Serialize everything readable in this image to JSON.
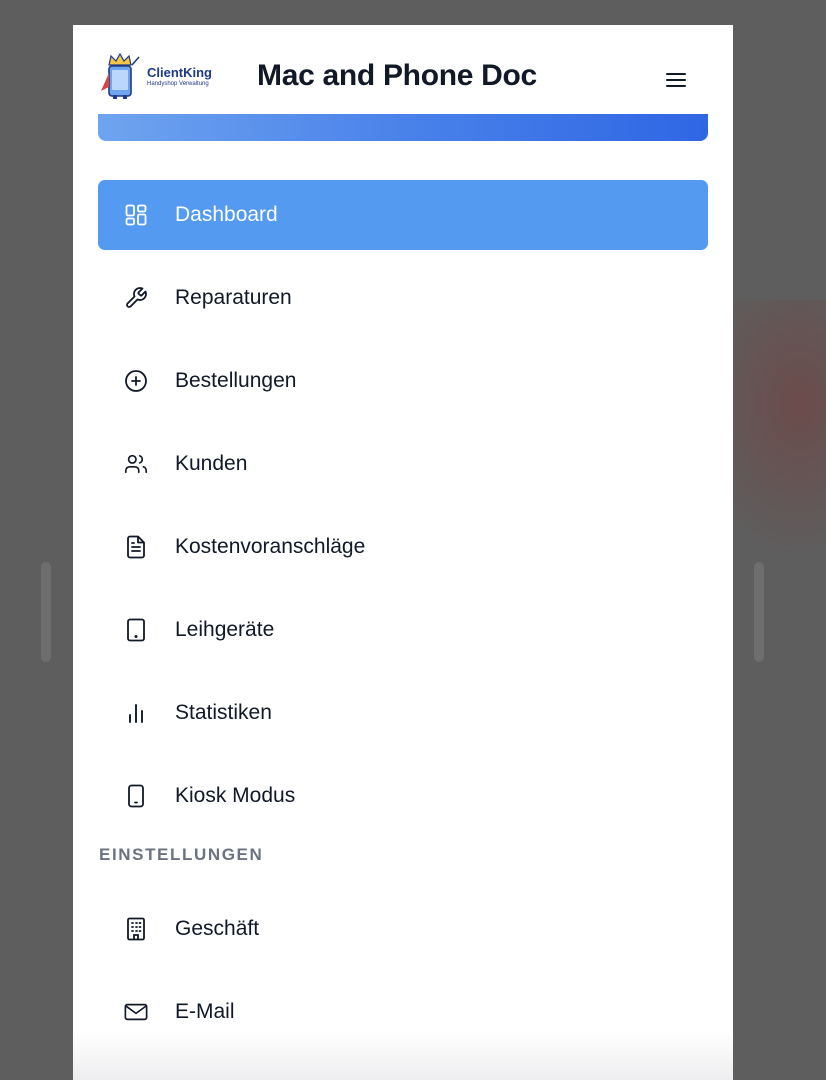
{
  "app": {
    "logo_name": "ClientKing",
    "logo_tagline": "Handyshop Verwaltung",
    "title": "Mac and Phone Doc"
  },
  "nav": {
    "items": [
      {
        "label": "Dashboard",
        "icon": "grid-icon",
        "active": true
      },
      {
        "label": "Reparaturen",
        "icon": "wrench-icon"
      },
      {
        "label": "Bestellungen",
        "icon": "plus-circle-icon"
      },
      {
        "label": "Kunden",
        "icon": "users-icon"
      },
      {
        "label": "Kostenvoranschläge",
        "icon": "document-icon"
      },
      {
        "label": "Leihgeräte",
        "icon": "tablet-icon"
      },
      {
        "label": "Statistiken",
        "icon": "bar-chart-icon"
      },
      {
        "label": "Kiosk Modus",
        "icon": "phone-icon"
      }
    ],
    "settings_heading": "EINSTELLUNGEN",
    "settings_items": [
      {
        "label": "Geschäft",
        "icon": "building-icon"
      },
      {
        "label": "E-Mail",
        "icon": "mail-icon"
      }
    ]
  },
  "colors": {
    "active_bg": "#539af0",
    "accent_gradient_end": "#2f66e4",
    "text": "#111827",
    "muted": "#6b7280"
  }
}
